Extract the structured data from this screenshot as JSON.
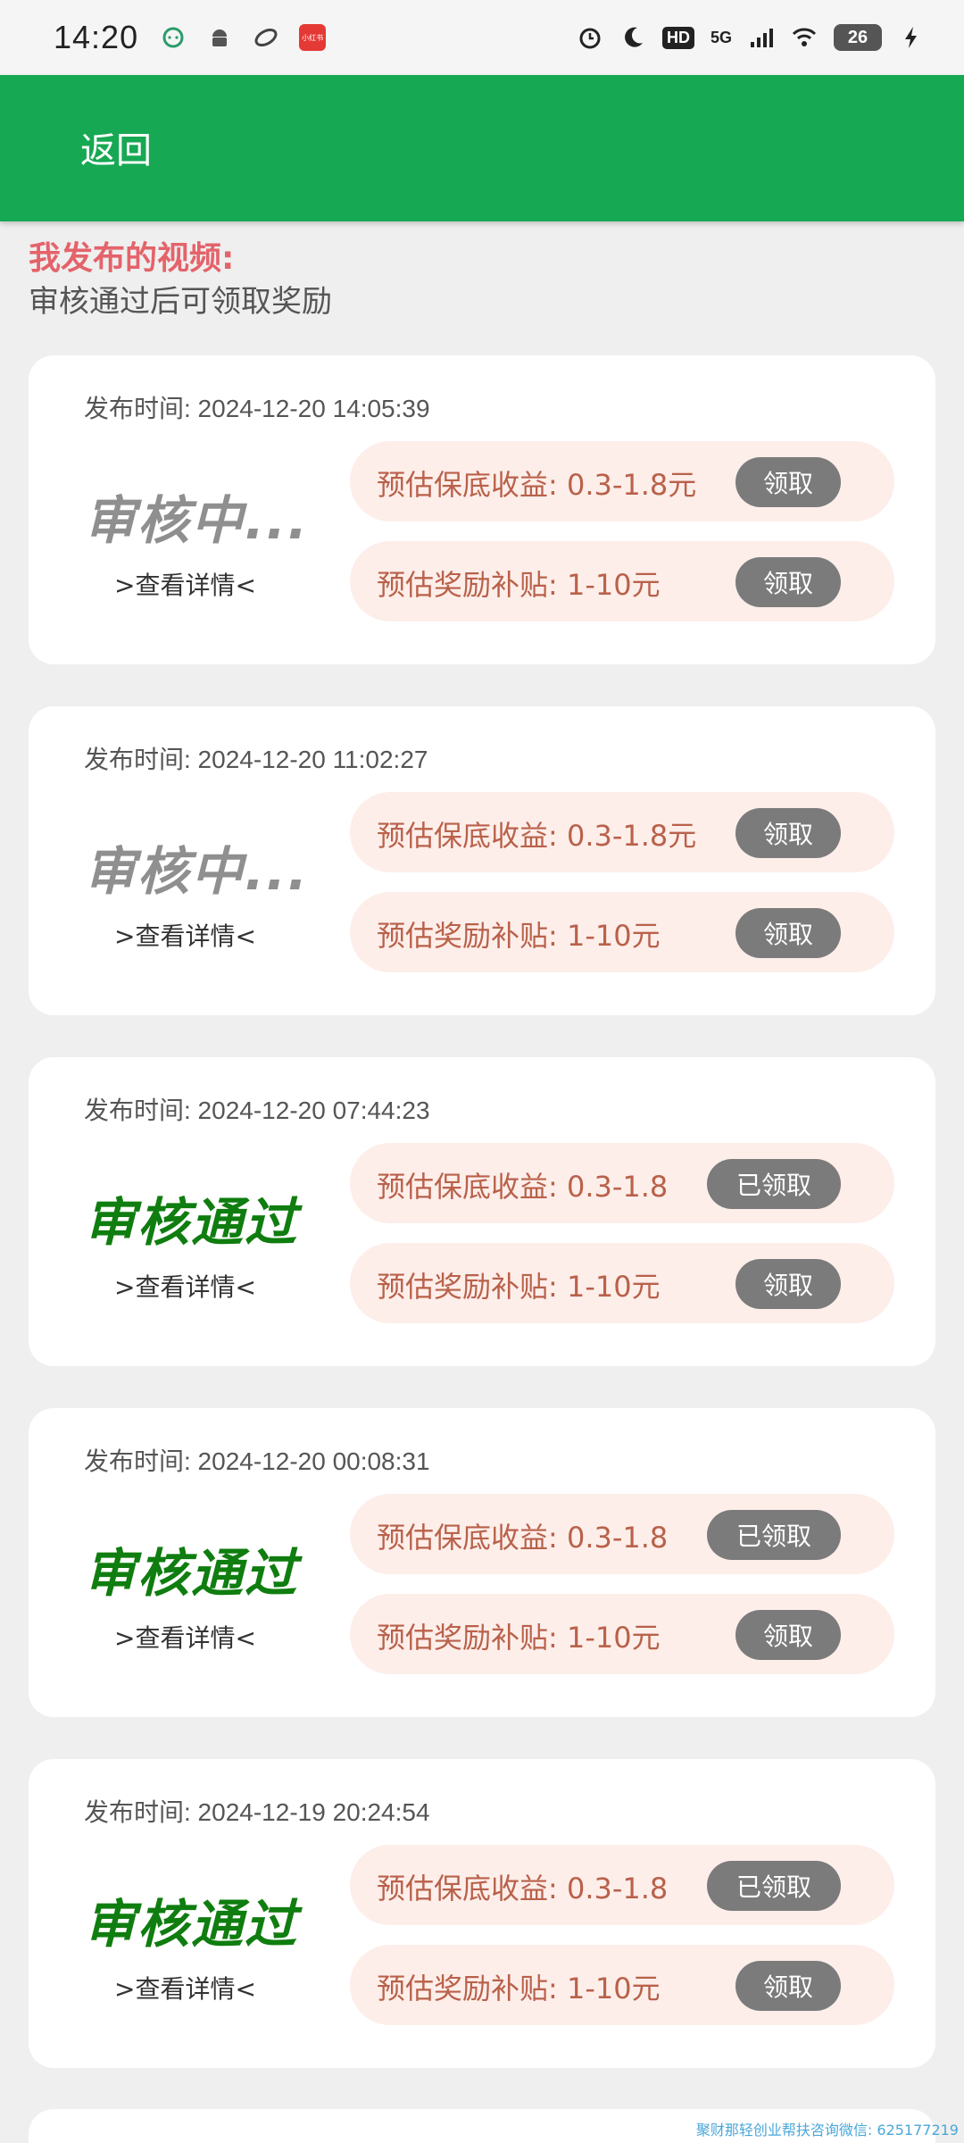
{
  "status_bar": {
    "time": "14:20",
    "left_icons": [
      "chat-bubble-icon",
      "android-icon",
      "sync-icon",
      "app-badge-icon"
    ],
    "app_badge_text": "小红书",
    "hd": "HD",
    "network": "5G",
    "battery": "26"
  },
  "header": {
    "back_label": "返回",
    "color": "#17a853"
  },
  "intro": {
    "title": "我发布的视频:",
    "subtitle": "审核通过后可领取奖励"
  },
  "cards": [
    {
      "time": "发布时间: 2024-12-20 14:05:39",
      "status": "审核中...",
      "detail": ">查看详情<",
      "income": "预估保底收益: 0.3-1.8元",
      "income_btn": "领取",
      "reward": "预估奖励补贴: 1-10元",
      "reward_btn": "领取"
    },
    {
      "time": "发布时间: 2024-12-20 11:02:27",
      "status": "审核中...",
      "detail": ">查看详情<",
      "income": "预估保底收益: 0.3-1.8元",
      "income_btn": "领取",
      "reward": "预估奖励补贴: 1-10元",
      "reward_btn": "领取"
    },
    {
      "time": "发布时间: 2024-12-20 07:44:23",
      "status": "审核通过",
      "detail": ">查看详情<",
      "income": "预估保底收益: 0.3-1.8",
      "income_btn": "已领取",
      "reward": "预估奖励补贴: 1-10元",
      "reward_btn": "领取"
    },
    {
      "time": "发布时间: 2024-12-20 00:08:31",
      "status": "审核通过",
      "detail": ">查看详情<",
      "income": "预估保底收益: 0.3-1.8",
      "income_btn": "已领取",
      "reward": "预估奖励补贴: 1-10元",
      "reward_btn": "领取"
    },
    {
      "time": "发布时间: 2024-12-19 20:24:54",
      "status": "审核通过",
      "detail": ">查看详情<",
      "income": "预估保底收益: 0.3-1.8",
      "income_btn": "已领取",
      "reward": "预估奖励补贴: 1-10元",
      "reward_btn": "领取"
    }
  ],
  "watermark": "聚财那轻创业帮扶咨询微信: 625177219"
}
